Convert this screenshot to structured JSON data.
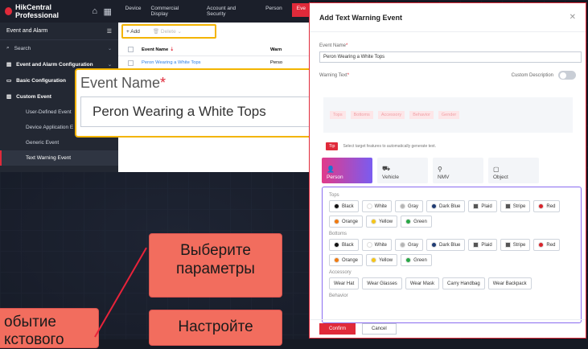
{
  "app": {
    "brand": "HikCentral Professional",
    "nav": [
      "Device",
      "Commercial Display",
      "Account and Security",
      "Person",
      "Eve"
    ],
    "active_nav_index": 4
  },
  "sidebar": {
    "header": "Event and Alarm",
    "search": "Search",
    "groups": [
      {
        "label": "Event and Alarm Configuration"
      },
      {
        "label": "Basic Configuration"
      },
      {
        "label": "Custom Event"
      }
    ],
    "sub_items": [
      "User-Defined Event",
      "Device Application E",
      "Generic Event",
      "Text Warning Event"
    ],
    "active_sub": "Text Warning Event"
  },
  "list": {
    "add_label": "Add",
    "delete_label": "Delete",
    "col_event_name": "Event Name",
    "col_warning": "Warn",
    "row_name": "Peron Wearing a White Tops",
    "row_warning": "Perso"
  },
  "callout": {
    "label": "Event Name",
    "value": "Peron Wearing a White Tops"
  },
  "dialog": {
    "title": "Add Text Warning Event",
    "event_name_label": "Event Name",
    "event_name_value": "Peron Wearing a White Tops",
    "warning_text_label": "Warning Text",
    "custom_description_label": "Custom Description",
    "custom_description_on": false,
    "warning_chips": [
      "Tops",
      "Bottoms",
      "Accessory",
      "Behavior",
      "Gender"
    ],
    "tip_badge": "Tip",
    "tip_text": "Select target features to automatically generate text.",
    "targets": [
      {
        "label": "Person",
        "icon": "person-icon"
      },
      {
        "label": "Vehicle",
        "icon": "vehicle-icon"
      },
      {
        "label": "NMV",
        "icon": "bicycle-icon"
      },
      {
        "label": "Object",
        "icon": "object-icon"
      }
    ],
    "active_target": "Person",
    "groups": {
      "tops": {
        "label": "Tops",
        "colors": [
          {
            "label": "Black",
            "hex": "#111111"
          },
          {
            "label": "White",
            "hex": "#ffffff"
          },
          {
            "label": "Gray",
            "hex": "#b5b5b5"
          },
          {
            "label": "Dark Blue",
            "hex": "#1f3b73"
          },
          {
            "label": "Plaid",
            "hex": "#555555"
          },
          {
            "label": "Stripe",
            "hex": "#555555"
          },
          {
            "label": "Red",
            "hex": "#d8232a"
          },
          {
            "label": "Orange",
            "hex": "#f07a10"
          },
          {
            "label": "Yellow",
            "hex": "#f5c518"
          },
          {
            "label": "Green",
            "hex": "#27a745"
          }
        ]
      },
      "bottoms": {
        "label": "Bottoms",
        "colors": [
          {
            "label": "Black",
            "hex": "#111111"
          },
          {
            "label": "White",
            "hex": "#ffffff"
          },
          {
            "label": "Gray",
            "hex": "#b5b5b5"
          },
          {
            "label": "Dark Blue",
            "hex": "#1f3b73"
          },
          {
            "label": "Plaid",
            "hex": "#555555"
          },
          {
            "label": "Stripe",
            "hex": "#555555"
          },
          {
            "label": "Red",
            "hex": "#d8232a"
          },
          {
            "label": "Orange",
            "hex": "#f07a10"
          },
          {
            "label": "Yellow",
            "hex": "#f5c518"
          },
          {
            "label": "Green",
            "hex": "#27a745"
          }
        ]
      },
      "accessory": {
        "label": "Accessory",
        "items": [
          "Wear Hat",
          "Wear Glasses",
          "Wear Mask",
          "Carry Handbag",
          "Wear Backpack"
        ]
      },
      "behavior": {
        "label": "Behavior"
      }
    },
    "confirm": "Confirm",
    "cancel": "Cancel"
  },
  "annotations": {
    "select_params": "Выберите параметры",
    "configure": "Настройте",
    "event_partial_1": "обытие",
    "event_partial_2": "кстового"
  },
  "colors": {
    "accent": "#e02a3a",
    "highlight": "#f3b400",
    "annotation": "#f26d5e"
  }
}
